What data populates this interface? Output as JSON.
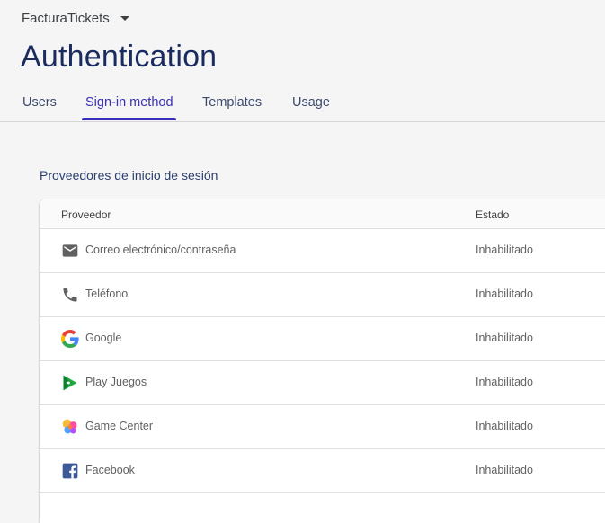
{
  "project": {
    "name": "FacturaTickets"
  },
  "page": {
    "title": "Authentication"
  },
  "tabs": [
    {
      "label": "Users"
    },
    {
      "label": "Sign-in method"
    },
    {
      "label": "Templates"
    },
    {
      "label": "Usage"
    }
  ],
  "active_tab": "Sign-in method",
  "section": {
    "title": "Proveedores de inicio de sesión"
  },
  "table": {
    "headers": {
      "provider": "Proveedor",
      "status": "Estado"
    },
    "rows": [
      {
        "icon": "email-icon",
        "provider": "Correo electrónico/contraseña",
        "status": "Inhabilitado"
      },
      {
        "icon": "phone-icon",
        "provider": "Teléfono",
        "status": "Inhabilitado"
      },
      {
        "icon": "google-icon",
        "provider": "Google",
        "status": "Inhabilitado"
      },
      {
        "icon": "play-games-icon",
        "provider": "Play Juegos",
        "status": "Inhabilitado"
      },
      {
        "icon": "game-center-icon",
        "provider": "Game Center",
        "status": "Inhabilitado"
      },
      {
        "icon": "facebook-icon",
        "provider": "Facebook",
        "status": "Inhabilitado"
      }
    ]
  },
  "colors": {
    "accent": "#3a2fb8",
    "title": "#1a2b5f",
    "background": "#f5f5f5"
  }
}
